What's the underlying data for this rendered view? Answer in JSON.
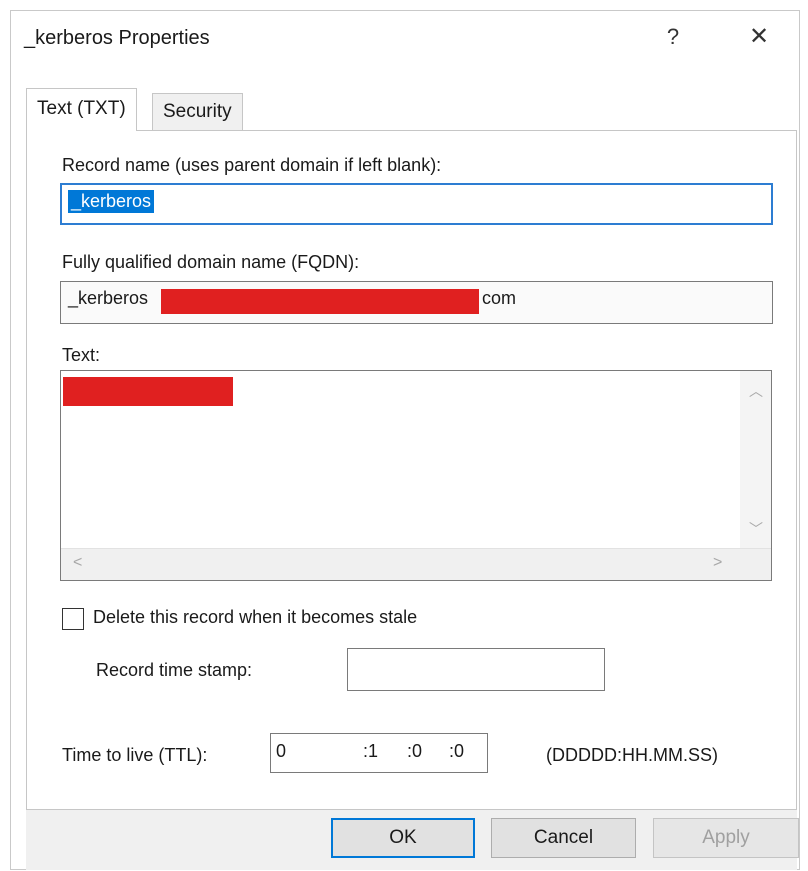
{
  "dialog": {
    "title": "_kerberos Properties",
    "help_label": "?",
    "close_label": "✕"
  },
  "tabs": [
    {
      "label": "Text (TXT)",
      "active": true
    },
    {
      "label": "Security",
      "active": false
    }
  ],
  "form": {
    "record_name_label": "Record name (uses parent domain if left blank):",
    "record_name_value": "_kerberos",
    "fqdn_label": "Fully qualified domain name (FQDN):",
    "fqdn_prefix": "_kerberos",
    "fqdn_suffix": "com",
    "text_label": "Text:",
    "stale_label": "Delete this record when it becomes stale",
    "stale_checked": false,
    "timestamp_label": "Record time stamp:",
    "timestamp_value": "",
    "ttl_label": "Time to live (TTL):",
    "ttl_days": "0",
    "ttl_hours": ":1",
    "ttl_minutes": ":0",
    "ttl_seconds": ":0",
    "ttl_format": "(DDDDD:HH.MM.SS)"
  },
  "buttons": {
    "ok": "OK",
    "cancel": "Cancel",
    "apply": "Apply"
  },
  "colors": {
    "accent": "#0078d7",
    "redaction": "#e02020"
  }
}
